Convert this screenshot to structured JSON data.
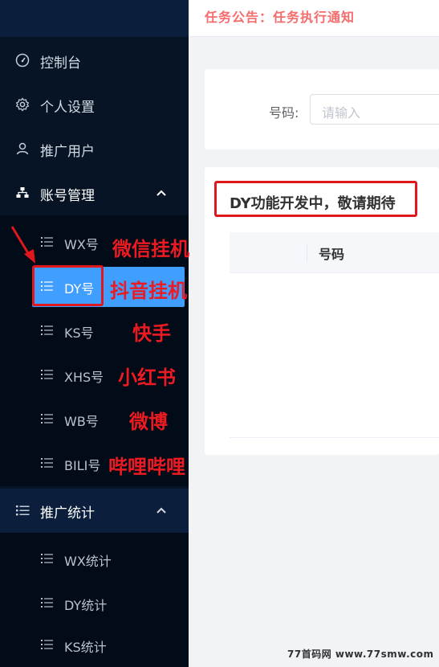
{
  "notice": {
    "text": "任务公告：任务执行通知"
  },
  "sidebar": {
    "items": [
      {
        "label": "控制台",
        "icon": "dashboard-icon"
      },
      {
        "label": "个人设置",
        "icon": "gear-icon"
      },
      {
        "label": "推广用户",
        "icon": "user-icon"
      },
      {
        "label": "账号管理",
        "icon": "org-chart-icon",
        "expanded": true
      }
    ],
    "account_sub": [
      {
        "label": "WX号"
      },
      {
        "label": "DY号",
        "active": true
      },
      {
        "label": "KS号"
      },
      {
        "label": "XHS号"
      },
      {
        "label": "WB号"
      },
      {
        "label": "BILI号"
      }
    ],
    "stats": {
      "label": "推广统计",
      "icon": "list-icon",
      "expanded": true
    },
    "stats_sub": [
      {
        "label": "WX统计"
      },
      {
        "label": "DY统计"
      },
      {
        "label": "KS统计"
      }
    ]
  },
  "search": {
    "label": "号码:",
    "placeholder": "请输入"
  },
  "table": {
    "dev_notice": "DY功能开发中，敬请期待",
    "columns": [
      "号码"
    ]
  },
  "annotations": [
    "微信挂机",
    "抖音挂机",
    "快手",
    "小红书",
    "微博",
    "哔哩哔哩"
  ],
  "watermark": "77首码网 www.77smw.com",
  "colors": {
    "sidebar_bg": "#061426",
    "active_bg": "#409eff",
    "notice_red": "#f56c6c",
    "annotation_red": "#e0171c"
  }
}
